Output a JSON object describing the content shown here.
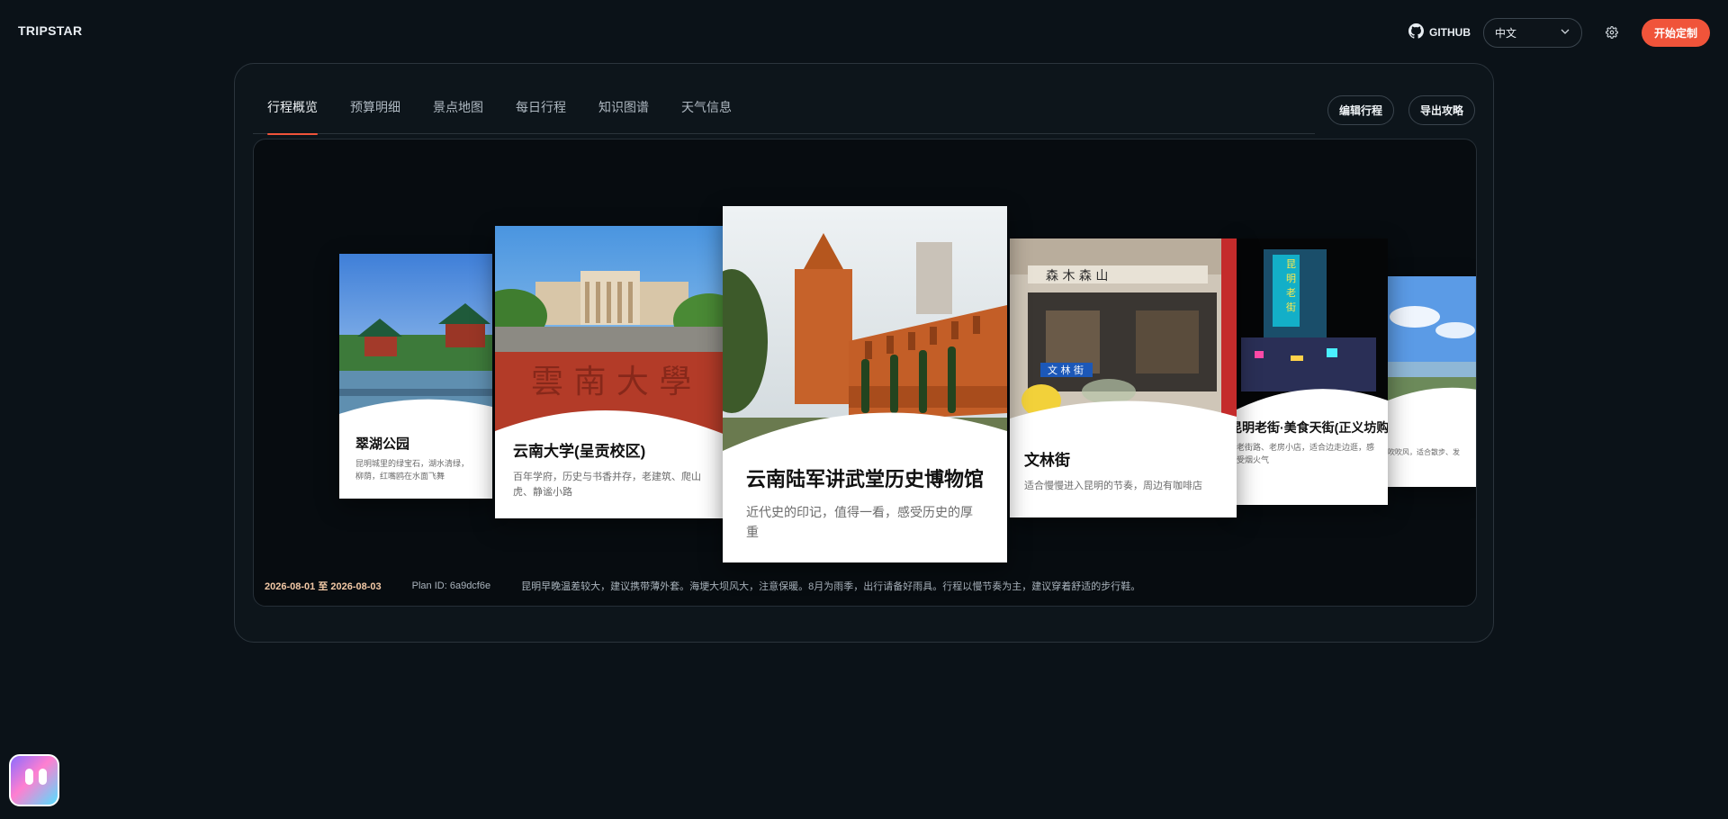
{
  "app": {
    "brand": "TRIPSTAR"
  },
  "header": {
    "github_label": "GITHUB",
    "language": "中文",
    "cta_label": "开始定制",
    "accent": "#f0543a"
  },
  "tabs": [
    {
      "label": "行程概览",
      "active": true
    },
    {
      "label": "预算明细",
      "active": false
    },
    {
      "label": "景点地图",
      "active": false
    },
    {
      "label": "每日行程",
      "active": false
    },
    {
      "label": "知识图谱",
      "active": false
    },
    {
      "label": "天气信息",
      "active": false
    }
  ],
  "actions": {
    "edit": "编辑行程",
    "export": "导出攻略"
  },
  "cards": [
    {
      "title": "翠湖公园",
      "desc": "昆明城里的绿宝石，湖水清绿，柳荫，红嘴鸥在水面飞舞"
    },
    {
      "title": "云南大学(呈贡校区)",
      "desc": "百年学府，历史与书香并存，老建筑、爬山虎、静谧小路"
    },
    {
      "title": "云南陆军讲武堂历史博物馆",
      "desc": "近代史的印记，值得一看，感受历史的厚重"
    },
    {
      "title": "文林街",
      "desc": "适合慢慢进入昆明的节奏，周边有咖啡店"
    },
    {
      "title": "昆明老街·美食天街(正义坊购物",
      "desc": "老街路、老房小店，适合边走边逛，感受烟火气"
    },
    {
      "title": "",
      "desc": "吹吹风，适合散步、发"
    }
  ],
  "footer": {
    "dates": "2026-08-01 至 2026-08-03",
    "plan_id": "Plan ID: 6a9dcf6e",
    "tip": "昆明早晚温差较大，建议携带薄外套。海埂大坝风大，注意保暖。8月为雨季，出行请备好雨具。行程以慢节奏为主，建议穿着舒适的步行鞋。"
  }
}
